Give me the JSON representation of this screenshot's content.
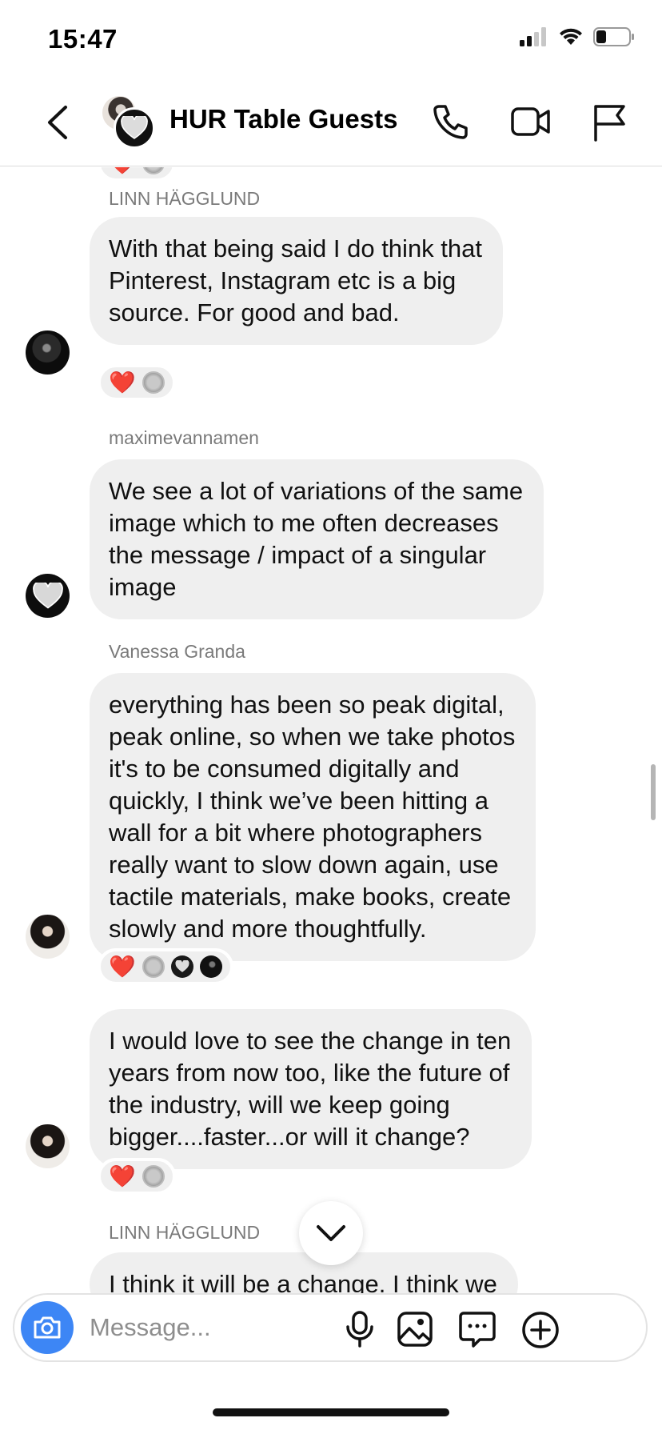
{
  "status_bar": {
    "time": "15:47"
  },
  "header": {
    "title": "HUR Table Guests"
  },
  "messages": [
    {
      "sender": "LINN HÄGGLUND",
      "lines": [
        "With that being said I do think that",
        "Pinterest, Instagram etc is a big",
        "source. For good and bad."
      ]
    },
    {
      "sender": "maximevannamen",
      "lines": [
        "We see a lot of variations of the same",
        "image which to me often decreases",
        "the message / impact of a singular",
        "image"
      ]
    },
    {
      "sender": "Vanessa Granda",
      "lines": [
        "everything has been so peak digital,",
        "peak online, so when we take photos",
        "it's to be consumed digitally and",
        "quickly, I think we’ve been hitting a",
        "wall for a bit where photographers",
        "really want to slow down again, use",
        "tactile materials, make books, create",
        "slowly and more thoughtfully."
      ]
    },
    {
      "sender": "",
      "lines": [
        "I would love to see the change in ten",
        "years from now too, like the future of",
        "the industry, will we keep going",
        "bigger....faster...or will it change?"
      ]
    },
    {
      "sender": "LINN HÄGGLUND",
      "lines": [
        "I think it will be a change. I think we"
      ]
    }
  ],
  "reactions": {
    "heart": "❤️"
  },
  "composer": {
    "placeholder": "Message..."
  },
  "colors": {
    "camera_button": "#3d86f5",
    "bubble": "#efefef",
    "sender_name": "#7a7a7a"
  },
  "icons": [
    "back-arrow-icon",
    "phone-icon",
    "video-camera-icon",
    "flag-icon",
    "camera-icon",
    "microphone-icon",
    "image-icon",
    "sticker-icon",
    "plus-icon",
    "chevron-down-icon"
  ]
}
